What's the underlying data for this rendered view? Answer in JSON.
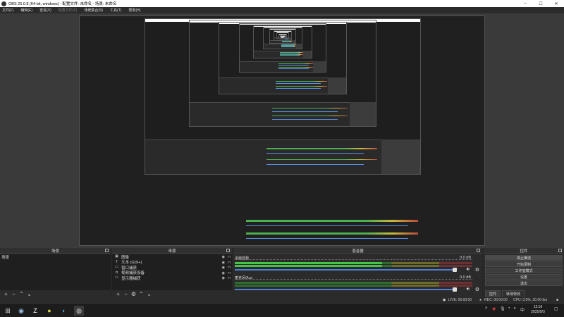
{
  "window": {
    "title": "OBS 25.0.8 (64-bit, windows) - 配置文件: 未命名 - 场景: 未命名",
    "minimize_glyph": "─",
    "maximize_glyph": "☐",
    "close_glyph": "✕"
  },
  "menu": [
    {
      "label": "文件(F)",
      "disabled": false
    },
    {
      "label": "编辑(E)",
      "disabled": false
    },
    {
      "label": "查看(V)",
      "disabled": false
    },
    {
      "label": "配置文件(P)",
      "disabled": true
    },
    {
      "label": "场景集合(S)",
      "disabled": false
    },
    {
      "label": "工具(T)",
      "disabled": false
    },
    {
      "label": "帮助(H)",
      "disabled": false
    }
  ],
  "scenes": {
    "title": "场景",
    "items": [
      "场景"
    ]
  },
  "sources": {
    "title": "来源",
    "items": [
      {
        "label": "图像",
        "icon": "image-icon"
      },
      {
        "label": "文本 (GDI+)",
        "icon": "text-icon"
      },
      {
        "label": "窗口捕获",
        "icon": "window-capture-icon"
      },
      {
        "label": "视频捕获设备",
        "icon": "camera-icon"
      },
      {
        "label": "显示器捕获",
        "icon": "monitor-icon"
      }
    ]
  },
  "mixer": {
    "title": "混音器",
    "channels": [
      {
        "name": "桌面音频",
        "db": "0.0 dB",
        "level": 0.62
      },
      {
        "name": "麦克风/Aux",
        "db": "0.0 dB",
        "level": 0.0
      }
    ]
  },
  "controls": {
    "title": "控件",
    "buttons": [
      "停止推流",
      "开始录制",
      "工作室模式",
      "设置",
      "退出"
    ],
    "tabs": [
      "控件",
      "转场特效"
    ]
  },
  "statusbar": {
    "live": "LIVE: 00:00:00",
    "rec": "REC: 00:00:00",
    "cpu": "CPU: 0.5%, 30.00 fps"
  },
  "taskbar": {
    "time": "12:16",
    "date": "2025/9/3",
    "lang": "中"
  },
  "colors": {
    "meter_green": "#47c247",
    "slider_blue": "#4f7fd4",
    "background": "#2b2b2b"
  }
}
